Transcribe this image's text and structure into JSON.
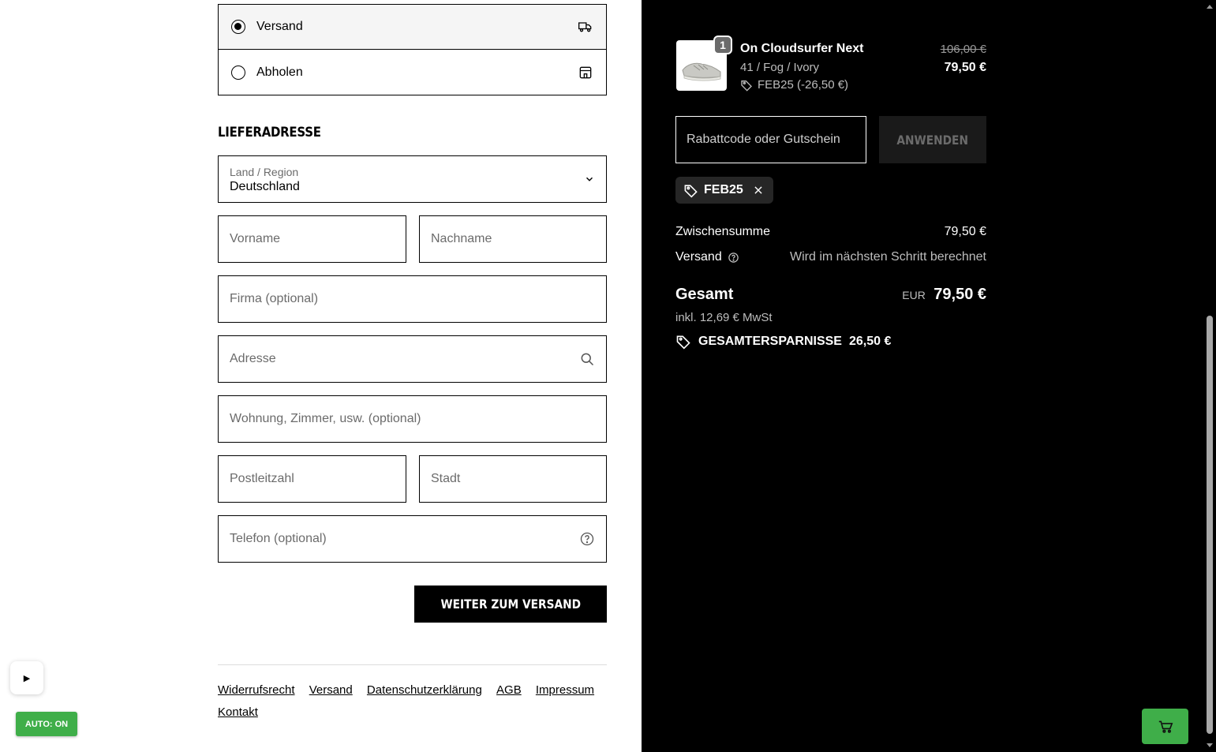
{
  "delivery": {
    "shipping_label": "Versand",
    "pickup_label": "Abholen"
  },
  "address": {
    "title": "LIEFERADRESSE",
    "country_label": "Land / Region",
    "country_value": "Deutschland",
    "first_name_placeholder": "Vorname",
    "last_name_placeholder": "Nachname",
    "company_placeholder": "Firma (optional)",
    "address_placeholder": "Adresse",
    "apartment_placeholder": "Wohnung, Zimmer, usw. (optional)",
    "zip_placeholder": "Postleitzahl",
    "city_placeholder": "Stadt",
    "phone_placeholder": "Telefon (optional)"
  },
  "continue_button": "WEITER ZUM VERSAND",
  "footer_links": [
    "Widerrufsrecht",
    "Versand",
    "Datenschutzerklärung",
    "AGB",
    "Impressum",
    "Kontakt"
  ],
  "overlay": {
    "play_glyph": "▶",
    "auto_label": "AUTO: ON"
  },
  "summary": {
    "product": {
      "quantity": "1",
      "name": "On Cloudsurfer Next",
      "variant": "41 / Fog / Ivory",
      "discount": "FEB25 (-26,50 €)",
      "old_price": "106,00 €",
      "price": "79,50 €"
    },
    "discount_placeholder": "Rabattcode oder Gutschein",
    "apply_button": "ANWENDEN",
    "applied_code": "FEB25",
    "subtotal_label": "Zwischensumme",
    "subtotal_value": "79,50 €",
    "shipping_label": "Versand",
    "shipping_value": "Wird im nächsten Schritt berechnet",
    "total_label": "Gesamt",
    "currency": "EUR",
    "total_value": "79,50 €",
    "tax_note": "inkl. 12,69 € MwSt",
    "savings_label": "GESAMTERSPARNISSE",
    "savings_value": "26,50 €"
  }
}
